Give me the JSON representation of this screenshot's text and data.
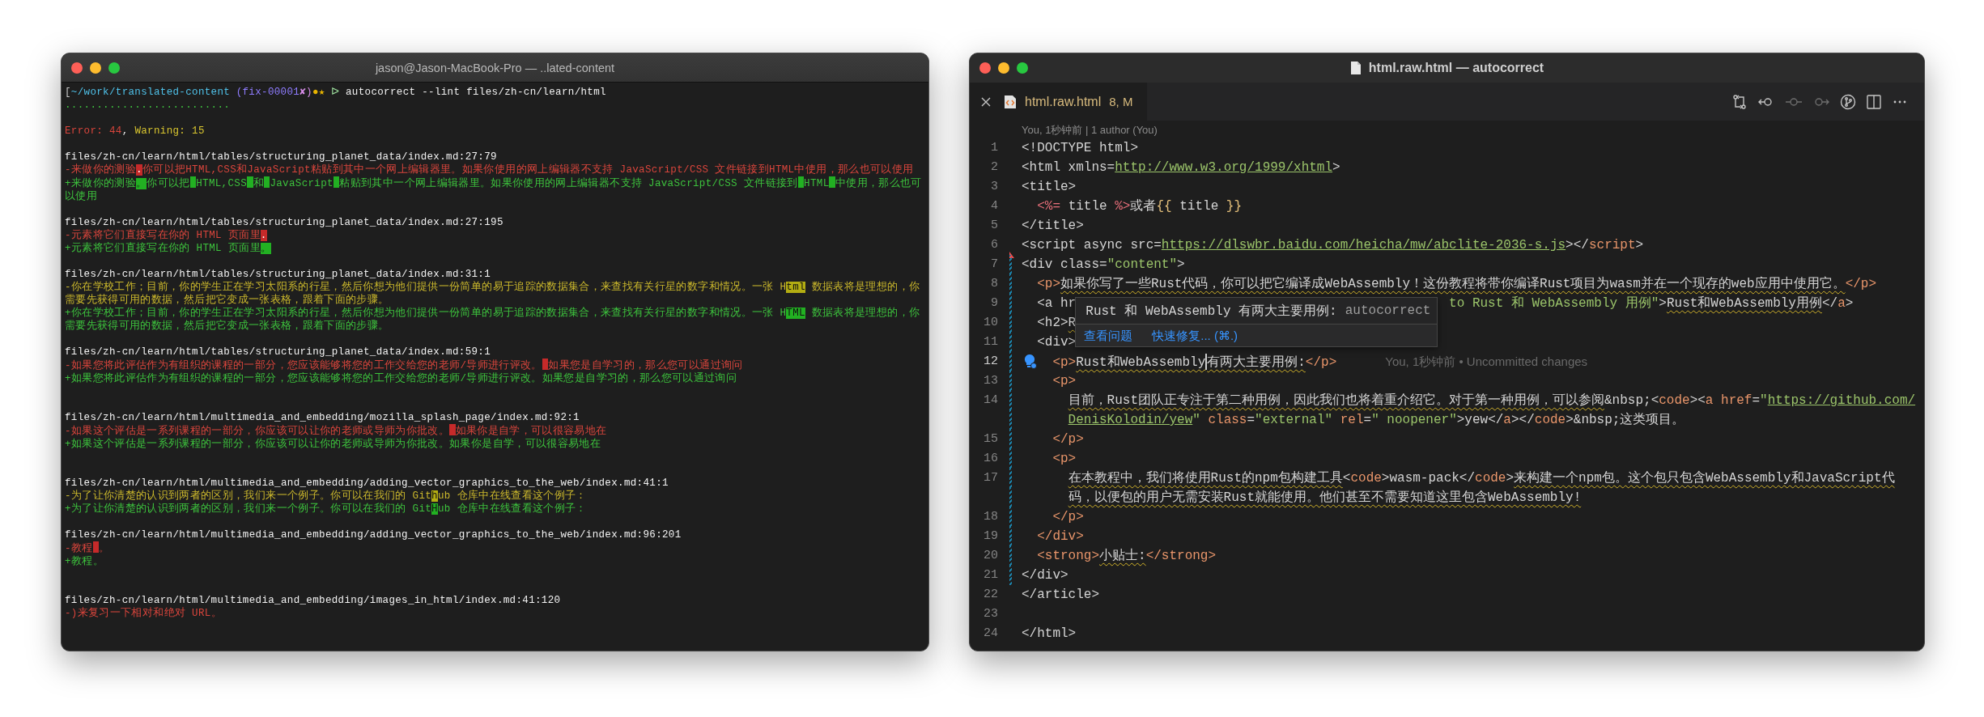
{
  "terminal": {
    "title": "jason@Jason-MacBook-Pro — ..lated-content",
    "lines": [
      {
        "kind": "prompt",
        "spans": [
          {
            "text": "[",
            "kind": "bracket"
          },
          {
            "text": "~/work/translated-content",
            "kind": "cwd"
          },
          {
            "text": "(fix-00001",
            "kind": "branch"
          },
          {
            "text": "✘)",
            "kind": "dirty"
          },
          {
            "text": "●★",
            "kind": "status"
          },
          {
            "text": "ᐅ",
            "kind": "arrow"
          },
          {
            "text": "autocorrect --lint files/zh-cn/learn/html",
            "kind": "command"
          }
        ]
      },
      {
        "kind": "progress",
        "text": ".........................."
      },
      {
        "kind": "blank"
      },
      {
        "kind": "summary",
        "spans": [
          {
            "text": "Error: 44",
            "kind": "error"
          },
          {
            "text": ", ",
            "kind": "plain"
          },
          {
            "text": "Warning: 15",
            "kind": "warning"
          }
        ]
      },
      {
        "kind": "blank"
      },
      {
        "kind": "path",
        "text": "files/zh-cn/learn/html/tables/structuring_planet_data/index.md:27:79"
      },
      {
        "kind": "removed_error",
        "spans": [
          {
            "text": "-来做你的测验",
            "highlight": false
          },
          {
            "text": ".",
            "highlight": true
          },
          {
            "text": "你可以把HTML,CSS和JavaScript粘贴到其中一个网上编辑器里。如果你使用的网上编辑器不支持 JavaScript/CSS 文件链接到HTML中使用，那么也可以使用",
            "highlight": false
          }
        ]
      },
      {
        "kind": "added",
        "spans": [
          {
            "text": "+来做你的测验",
            "highlight": false
          },
          {
            "text": "。",
            "highlight": true
          },
          {
            "text": "你可以把",
            "highlight": false
          },
          {
            "kind": "gap"
          },
          {
            "text": "HTML,CSS",
            "highlight": false
          },
          {
            "kind": "gap"
          },
          {
            "text": "和",
            "highlight": false
          },
          {
            "kind": "gap"
          },
          {
            "text": "JavaScript",
            "highlight": false
          },
          {
            "kind": "gap"
          },
          {
            "text": "粘贴到其中一个网上编辑器里。如果你使用的网上编辑器不支持 JavaScript/CSS 文件链接到",
            "highlight": false
          },
          {
            "kind": "gap"
          },
          {
            "text": "HTML",
            "highlight": false
          },
          {
            "kind": "gap"
          },
          {
            "text": "中使用，那么也可以使用",
            "highlight": false
          }
        ]
      },
      {
        "kind": "blank"
      },
      {
        "kind": "path",
        "text": "files/zh-cn/learn/html/tables/structuring_planet_data/index.md:27:195"
      },
      {
        "kind": "removed_error",
        "spans": [
          {
            "text": "-元素将它们直接写在你的 HTML 页面里",
            "highlight": false
          },
          {
            "text": ".",
            "highlight": true
          }
        ]
      },
      {
        "kind": "added",
        "spans": [
          {
            "text": "+元素将它们直接写在你的 HTML 页面里",
            "highlight": false
          },
          {
            "text": "。",
            "highlight": true
          }
        ]
      },
      {
        "kind": "blank"
      },
      {
        "kind": "path",
        "text": "files/zh-cn/learn/html/tables/structuring_planet_data/index.md:31:1"
      },
      {
        "kind": "removed_warning",
        "spans": [
          {
            "text": "-你在学校工作；目前，你的学生正在学习太阳系的行星，然后你想为他们提供一份简单的易于追踪的数据集合，来查找有关行星的数字和情况。一张 H",
            "highlight": false
          },
          {
            "text": "tml",
            "highlight": true
          },
          {
            "text": " 数据表将是理想的，你需要先获得可用的数据，然后把它变成一张表格，跟着下面的步骤。",
            "highlight": false
          }
        ]
      },
      {
        "kind": "added",
        "spans": [
          {
            "text": "+你在学校工作；目前，你的学生正在学习太阳系的行星，然后你想为他们提供一份简单的易于追踪的数据集合，来查找有关行星的数字和情况。一张 H",
            "highlight": false
          },
          {
            "text": "TML",
            "highlight": true
          },
          {
            "text": " 数据表将是理想的，你需要先获得可用的数据，然后把它变成一张表格，跟着下面的步骤。",
            "highlight": false
          }
        ]
      },
      {
        "kind": "blank"
      },
      {
        "kind": "path",
        "text": "files/zh-cn/learn/html/tables/structuring_planet_data/index.md:59:1"
      },
      {
        "kind": "removed_error",
        "spans": [
          {
            "text": "-如果您将此评估作为有组织的课程的一部分，您应该能够将您的工作交给您的老师/导师进行评改。",
            "highlight": false
          },
          {
            "kind": "gap"
          },
          {
            "text": "如果您是自学习的，那么您可以通过询问",
            "highlight": false
          }
        ]
      },
      {
        "kind": "added",
        "spans": [
          {
            "text": "+如果您将此评估作为有组织的课程的一部分，您应该能够将您的工作交给您的老师/导师进行评改。如果您是自学习的，那么您可以通过询问",
            "highlight": false
          }
        ]
      },
      {
        "kind": "blank"
      },
      {
        "kind": "blank"
      },
      {
        "kind": "path",
        "text": "files/zh-cn/learn/html/multimedia_and_embedding/mozilla_splash_page/index.md:92:1"
      },
      {
        "kind": "removed_error",
        "spans": [
          {
            "text": "-如果这个评估是一系列课程的一部分，你应该可以让你的老师或导师为你批改。",
            "highlight": false
          },
          {
            "kind": "gap"
          },
          {
            "text": "如果你是自学，可以很容易地在",
            "highlight": false
          }
        ]
      },
      {
        "kind": "added",
        "spans": [
          {
            "text": "+如果这个评估是一系列课程的一部分，你应该可以让你的老师或导师为你批改。如果你是自学，可以很容易地在",
            "highlight": false
          }
        ]
      },
      {
        "kind": "blank"
      },
      {
        "kind": "blank"
      },
      {
        "kind": "path",
        "text": "files/zh-cn/learn/html/multimedia_and_embedding/adding_vector_graphics_to_the_web/index.md:41:1"
      },
      {
        "kind": "removed_warning",
        "spans": [
          {
            "text": "-为了让你清楚的认识到两者的区别，我们来一个例子。你可以在我们的 Git",
            "highlight": false
          },
          {
            "text": "h",
            "highlight": true
          },
          {
            "text": "ub 仓库中在线查看这个例子：",
            "highlight": false
          }
        ]
      },
      {
        "kind": "added",
        "spans": [
          {
            "text": "+为了让你清楚的认识到两者的区别，我们来一个例子。你可以在我们的 Git",
            "highlight": false
          },
          {
            "text": "H",
            "highlight": true
          },
          {
            "text": "ub 仓库中在线查看这个例子：",
            "highlight": false
          }
        ]
      },
      {
        "kind": "blank"
      },
      {
        "kind": "path",
        "text": "files/zh-cn/learn/html/multimedia_and_embedding/adding_vector_graphics_to_the_web/index.md:96:201"
      },
      {
        "kind": "removed_error",
        "spans": [
          {
            "text": "-教程",
            "highlight": false
          },
          {
            "kind": "gap"
          },
          {
            "text": "。",
            "highlight": false
          }
        ]
      },
      {
        "kind": "added",
        "spans": [
          {
            "text": "+教程。",
            "highlight": false
          }
        ]
      },
      {
        "kind": "blank"
      },
      {
        "kind": "blank"
      },
      {
        "kind": "path",
        "text": "files/zh-cn/learn/html/multimedia_and_embedding/images_in_html/index.md:41:120"
      },
      {
        "kind": "removed_error",
        "spans": [
          {
            "text": "-)来复习一下相对和绝对 URL。",
            "highlight": false
          }
        ]
      }
    ]
  },
  "editor": {
    "title": "html.raw.html — autocorrect",
    "tab": {
      "label": "html.raw.html",
      "badge": "8, M",
      "selected": true
    },
    "blame_header": "You, 1秒钟前 | 1 author (You)",
    "popup": {
      "message": "Rust 和 WebAssembly 有两大主要用例:",
      "source": "autocorrect",
      "actions": [
        "查看问题",
        "快速修复... (⌘.)"
      ]
    },
    "lines": [
      {
        "number": "1",
        "lightbulb": false,
        "active": false,
        "kind": "unchanged",
        "rows": [
          {
            "tokens": [
              {
                "text": "<!DOCTYPE html>",
                "kind": "plain"
              }
            ]
          }
        ]
      },
      {
        "number": "2",
        "lightbulb": false,
        "active": false,
        "kind": "unchanged",
        "rows": [
          {
            "tokens": [
              {
                "text": "<html xmlns=",
                "kind": "plain"
              },
              {
                "text": "http://www.w3.org/1999/xhtml",
                "kind": "link"
              },
              {
                "text": ">",
                "kind": "plain"
              }
            ]
          }
        ]
      },
      {
        "number": "3",
        "lightbulb": false,
        "active": false,
        "kind": "unchanged",
        "rows": [
          {
            "tokens": [
              {
                "text": "<title>",
                "kind": "plain"
              }
            ]
          }
        ]
      },
      {
        "number": "4",
        "lightbulb": false,
        "active": false,
        "kind": "unchanged",
        "rows": [
          {
            "tokens": [
              {
                "text": "  <%=",
                "kind": "template"
              },
              {
                "text": " title ",
                "kind": "plain"
              },
              {
                "text": "%>",
                "kind": "template"
              },
              {
                "text": "或者",
                "kind": "plain"
              },
              {
                "text": "{{",
                "kind": "brace"
              },
              {
                "text": " title ",
                "kind": "plain"
              },
              {
                "text": "}}",
                "kind": "brace"
              }
            ]
          }
        ]
      },
      {
        "number": "5",
        "lightbulb": false,
        "active": false,
        "kind": "unchanged",
        "rows": [
          {
            "tokens": [
              {
                "text": "</title>",
                "kind": "plain"
              }
            ]
          }
        ]
      },
      {
        "number": "6",
        "lightbulb": false,
        "active": false,
        "kind": "deleted",
        "rows": [
          {
            "tokens": [
              {
                "text": "<script async src=",
                "kind": "plain"
              },
              {
                "text": "https://dlswbr.baidu.com/heicha/mw/abclite-2036-s.js",
                "kind": "link"
              },
              {
                "text": "></",
                "kind": "plain"
              },
              {
                "text": "script",
                "kind": "tag"
              },
              {
                "text": ">",
                "kind": "plain"
              }
            ]
          }
        ]
      },
      {
        "number": "7",
        "lightbulb": false,
        "active": false,
        "kind": "modified",
        "rows": [
          {
            "tokens": [
              {
                "text": "<div class=",
                "kind": "plain"
              },
              {
                "text": "\"content\"",
                "kind": "string"
              },
              {
                "text": ">",
                "kind": "plain"
              }
            ]
          }
        ]
      },
      {
        "number": "8",
        "lightbulb": false,
        "active": false,
        "kind": "modified",
        "rows": [
          {
            "tokens": [
              {
                "text": "  <p>",
                "kind": "tag"
              },
              {
                "text": "如果你写了一些Rust代码，你可以把它编译成WebAssembly！这份教程将带你编译Rust项目为wasm并在一个现存的web应用中使用它。",
                "kind": "flagged"
              },
              {
                "text": "</p>",
                "kind": "tag"
              }
            ]
          }
        ]
      },
      {
        "number": "9",
        "lightbulb": false,
        "active": false,
        "kind": "modified",
        "rows": [
          {
            "tokens": [
              {
                "text": "  <a hr",
                "kind": "plain"
              }
            ]
          }
        ],
        "after_popup": [
          {
            "text": "to Rust 和 WebAssembly 用例\"",
            "kind": "string"
          },
          {
            "text": ">",
            "kind": "plain"
          },
          {
            "text": "Rust和WebAssembly用例",
            "kind": "flagged"
          },
          {
            "text": "</",
            "kind": "plain"
          },
          {
            "text": "a",
            "kind": "tag"
          },
          {
            "text": ">",
            "kind": "plain"
          }
        ]
      },
      {
        "number": "10",
        "lightbulb": false,
        "active": false,
        "kind": "modified",
        "rows": [
          {
            "tokens": [
              {
                "text": "  <h2>",
                "kind": "plain"
              },
              {
                "text": "R",
                "kind": "flagged"
              }
            ]
          }
        ]
      },
      {
        "number": "11",
        "lightbulb": false,
        "active": false,
        "kind": "modified",
        "rows": [
          {
            "tokens": [
              {
                "text": "  <div>",
                "kind": "plain"
              }
            ]
          }
        ]
      },
      {
        "number": "12",
        "active": true,
        "kind": "modified",
        "lightbulb": true,
        "blame": "You, 1秒钟前 • Uncommitted changes",
        "rows": [
          {
            "tokens": [
              {
                "text": "    <p>",
                "kind": "tag"
              },
              {
                "text": "Rust和WebAssembly",
                "kind": "flagged"
              },
              {
                "kind": "cursor"
              },
              {
                "text": "有两大主要用例:",
                "kind": "flagged"
              },
              {
                "text": "</p>",
                "kind": "tag"
              }
            ]
          }
        ]
      },
      {
        "number": "13",
        "lightbulb": false,
        "active": false,
        "kind": "modified",
        "rows": [
          {
            "tokens": [
              {
                "text": "    <p>",
                "kind": "tag"
              }
            ]
          }
        ]
      },
      {
        "number": "14",
        "lightbulb": false,
        "active": false,
        "kind": "modified",
        "rows": [
          {
            "tokens": [
              {
                "text": "      目前，Rust团队正专注于第二种用例，因此我们也将着重介绍它。对于第一种用例，可以参阅",
                "kind": "flagged"
              },
              {
                "text": "&nbsp;<",
                "kind": "plain"
              },
              {
                "text": "code",
                "kind": "tag"
              },
              {
                "text": "><",
                "kind": "plain"
              },
              {
                "text": "a href",
                "kind": "tag"
              },
              {
                "text": "=",
                "kind": "plain"
              },
              {
                "text": "\"",
                "kind": "string"
              },
              {
                "text": "https://github.com/",
                "kind": "link"
              }
            ]
          },
          {
            "tokens": [
              {
                "text": "DenisKolodin/yew",
                "kind": "link"
              },
              {
                "text": "\"",
                "kind": "string"
              },
              {
                "text": " class",
                "kind": "tag"
              },
              {
                "text": "=",
                "kind": "plain"
              },
              {
                "text": "\"external\"",
                "kind": "string"
              },
              {
                "text": " rel",
                "kind": "tag"
              },
              {
                "text": "=",
                "kind": "plain"
              },
              {
                "text": "\" noopener\"",
                "kind": "string"
              },
              {
                "text": ">yew</",
                "kind": "plain"
              },
              {
                "text": "a",
                "kind": "tag"
              },
              {
                "text": "></",
                "kind": "plain"
              },
              {
                "text": "code",
                "kind": "tag"
              },
              {
                "text": ">&nbsp;这类项目。",
                "kind": "plain"
              }
            ]
          }
        ]
      },
      {
        "number": "15",
        "lightbulb": false,
        "active": false,
        "kind": "modified",
        "rows": [
          {
            "tokens": [
              {
                "text": "    </p>",
                "kind": "tag"
              }
            ]
          }
        ]
      },
      {
        "number": "16",
        "lightbulb": false,
        "active": false,
        "kind": "modified",
        "rows": [
          {
            "tokens": [
              {
                "text": "    <p>",
                "kind": "tag"
              }
            ]
          }
        ]
      },
      {
        "number": "17",
        "lightbulb": false,
        "active": false,
        "kind": "modified",
        "rows": [
          {
            "tokens": [
              {
                "text": "      在本教程中，我们将使用Rust的npm包构建工具",
                "kind": "flagged"
              },
              {
                "text": "<",
                "kind": "plain"
              },
              {
                "text": "code",
                "kind": "tag"
              },
              {
                "text": ">wasm-pack</",
                "kind": "plain"
              },
              {
                "text": "code",
                "kind": "tag"
              },
              {
                "text": ">",
                "kind": "plain"
              },
              {
                "text": "来构建一个npm包。这个包只包含WebAssembly和JavaScript代",
                "kind": "flagged"
              }
            ]
          },
          {
            "tokens": [
              {
                "text": "码，以便包的用户无需安装Rust就能使用。他们甚至不需要知道这里包含WebAssembly!",
                "kind": "flagged"
              }
            ]
          }
        ]
      },
      {
        "number": "18",
        "lightbulb": false,
        "active": false,
        "kind": "modified",
        "rows": [
          {
            "tokens": [
              {
                "text": "    </p>",
                "kind": "tag"
              }
            ]
          }
        ]
      },
      {
        "number": "19",
        "lightbulb": false,
        "active": false,
        "kind": "modified",
        "rows": [
          {
            "tokens": [
              {
                "text": "  </div>",
                "kind": "tag"
              }
            ]
          }
        ]
      },
      {
        "number": "20",
        "lightbulb": false,
        "active": false,
        "kind": "modified",
        "rows": [
          {
            "tokens": [
              {
                "text": "  <strong>",
                "kind": "tag"
              },
              {
                "text": "小贴士:",
                "kind": "flagged"
              },
              {
                "text": "</strong>",
                "kind": "tag"
              }
            ]
          }
        ]
      },
      {
        "number": "21",
        "lightbulb": false,
        "active": false,
        "kind": "modified",
        "rows": [
          {
            "tokens": [
              {
                "text": "</div>",
                "kind": "plain"
              }
            ]
          }
        ]
      },
      {
        "number": "22",
        "lightbulb": false,
        "active": false,
        "kind": "unchanged",
        "rows": [
          {
            "tokens": [
              {
                "text": "</article>",
                "kind": "plain"
              }
            ]
          }
        ]
      },
      {
        "number": "23",
        "lightbulb": false,
        "active": false,
        "kind": "unchanged",
        "rows": [
          {
            "tokens": []
          }
        ]
      },
      {
        "number": "24",
        "lightbulb": false,
        "active": false,
        "kind": "unchanged",
        "rows": [
          {
            "tokens": [
              {
                "text": "</html>",
                "kind": "plain"
              }
            ]
          }
        ]
      }
    ]
  }
}
